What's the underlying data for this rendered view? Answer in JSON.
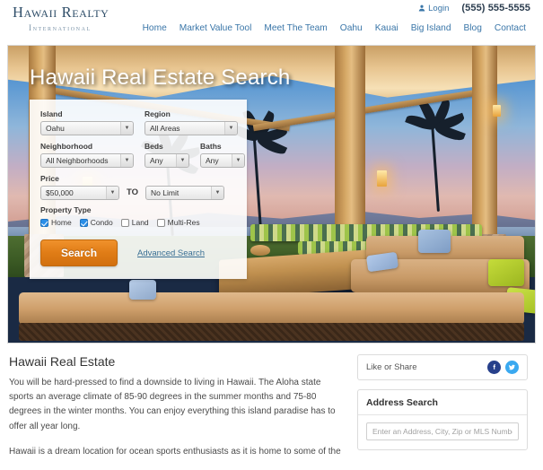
{
  "header": {
    "logo_main": "Hawaii Realty",
    "logo_sub": "International",
    "login_label": "Login",
    "phone": "(555) 555-5555",
    "nav": [
      {
        "label": "Home"
      },
      {
        "label": "Market Value Tool"
      },
      {
        "label": "Meet The Team"
      },
      {
        "label": "Oahu"
      },
      {
        "label": "Kauai"
      },
      {
        "label": "Big Island"
      },
      {
        "label": "Blog"
      },
      {
        "label": "Contact"
      }
    ]
  },
  "hero": {
    "title": "Hawaii Real Estate Search"
  },
  "search_form": {
    "island_label": "Island",
    "island_value": "Oahu",
    "region_label": "Region",
    "region_value": "All Areas",
    "neighborhood_label": "Neighborhood",
    "neighborhood_value": "All Neighborhoods",
    "beds_label": "Beds",
    "beds_value": "Any",
    "baths_label": "Baths",
    "baths_value": "Any",
    "price_label": "Price",
    "price_min_value": "$50,000",
    "to_label": "TO",
    "price_max_value": "No Limit",
    "property_type_label": "Property Type",
    "property_types": [
      {
        "label": "Home",
        "checked": true
      },
      {
        "label": "Condo",
        "checked": true
      },
      {
        "label": "Land",
        "checked": false
      },
      {
        "label": "Multi-Res",
        "checked": false
      }
    ],
    "search_button": "Search",
    "advanced_link": "Advanced Search"
  },
  "main": {
    "heading": "Hawaii Real Estate",
    "paragraph_1": "You will be hard-pressed to find a downside to living in Hawaii. The Aloha state sports an average climate of 85-90 degrees in the summer months and 75-80 degrees in the winter months. You can enjoy everything this island paradise has to offer all year long.",
    "paragraph_2": "Hawaii is a dream location for ocean sports enthusiasts as it is home to some of the"
  },
  "sidebar": {
    "share_label": "Like or Share",
    "facebook_icon": "facebook-icon",
    "twitter_icon": "twitter-icon",
    "address_search_title": "Address Search",
    "address_search_placeholder": "Enter an Address, City, Zip or MLS Number"
  },
  "colors": {
    "accent_orange": "#e07c16",
    "link_blue": "#3a76a8",
    "logo_navy": "#2e4d68",
    "checkbox_blue": "#2b8fe8",
    "facebook": "#27408b",
    "twitter": "#3aa9f0"
  }
}
